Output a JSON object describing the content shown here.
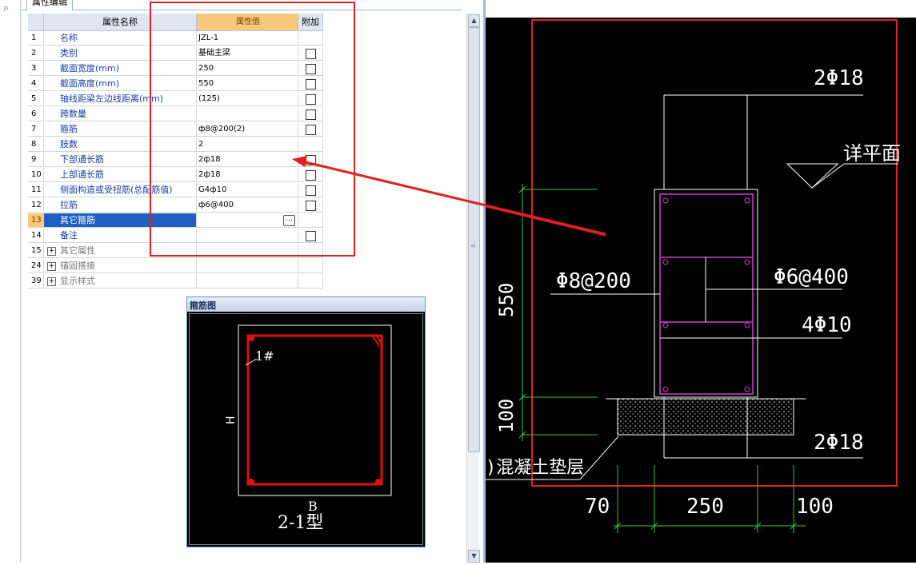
{
  "panel": {
    "tab_label": "属性编辑",
    "headers": {
      "name": "属性名称",
      "value": "属性值",
      "extra": "附加"
    },
    "rows": [
      {
        "num": "1",
        "name": "名称",
        "value": "JZL-1",
        "check": false
      },
      {
        "num": "2",
        "name": "类别",
        "value": "基础主梁",
        "check": true
      },
      {
        "num": "3",
        "name": "截面宽度(mm)",
        "value": "250",
        "check": true
      },
      {
        "num": "4",
        "name": "截面高度(mm)",
        "value": "550",
        "check": true
      },
      {
        "num": "5",
        "name": "轴线距梁左边线距离(mm)",
        "value": "(125)",
        "check": true
      },
      {
        "num": "6",
        "name": "跨数量",
        "value": "",
        "check": true
      },
      {
        "num": "7",
        "name": "箍筋",
        "value": "ф8@200(2)",
        "check": true
      },
      {
        "num": "8",
        "name": "肢数",
        "value": "2",
        "check": false
      },
      {
        "num": "9",
        "name": "下部通长筋",
        "value": "2ф18",
        "check": true
      },
      {
        "num": "10",
        "name": "上部通长筋",
        "value": "2ф18",
        "check": true
      },
      {
        "num": "11",
        "name": "侧面构造或受扭筋(总配筋值)",
        "value": "G4ф10",
        "check": true
      },
      {
        "num": "12",
        "name": "拉筋",
        "value": "ф6@400",
        "check": true
      },
      {
        "num": "13",
        "name": "其它箍筋",
        "value": "",
        "check": false,
        "selected": true
      },
      {
        "num": "14",
        "name": "备注",
        "value": "",
        "check": true
      }
    ],
    "groups": [
      {
        "num": "15",
        "name": "其它属性"
      },
      {
        "num": "24",
        "name": "锚固搭接"
      },
      {
        "num": "39",
        "name": "显示样式"
      }
    ]
  },
  "stirrup_window": {
    "title": "箍筋图",
    "rebar_label": "1#",
    "height_label": "H",
    "width_label": "B",
    "type_label": "2-1型"
  },
  "cad": {
    "top_rebar": "2Φ18",
    "bottom_rebar": "2Φ18",
    "stirrup": "Φ8@200",
    "tie": "Φ6@400",
    "side_rebar": "4Φ10",
    "note": "详平面",
    "height_dim": "550",
    "cushion_dim": "100",
    "cushion_label": ")混凝土垫层",
    "dim_left": "70",
    "dim_mid": "250",
    "dim_right": "100"
  },
  "colors": {
    "highlight_red": "#e02020",
    "selected_row": "#1f5fc3",
    "header_value": "#f7c77a",
    "cad_magenta": "#d040d0",
    "cad_green": "#40c040"
  }
}
